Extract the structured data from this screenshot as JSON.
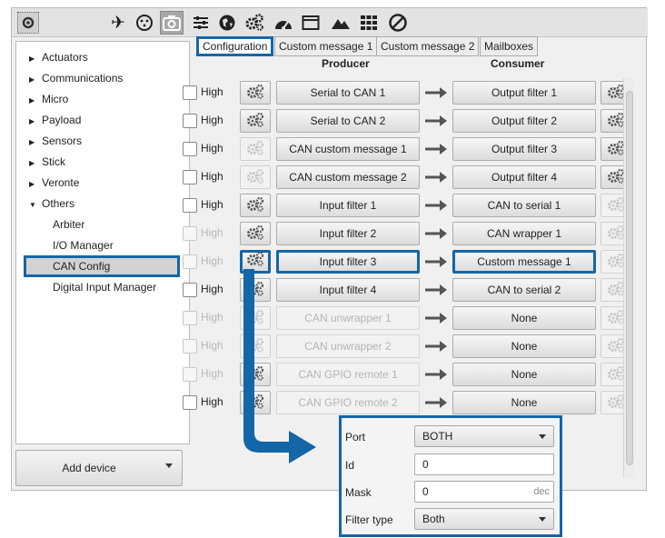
{
  "sidebar": {
    "items": [
      {
        "label": "Actuators",
        "expanded": false
      },
      {
        "label": "Communications",
        "expanded": false
      },
      {
        "label": "Micro",
        "expanded": false
      },
      {
        "label": "Payload",
        "expanded": false
      },
      {
        "label": "Sensors",
        "expanded": false
      },
      {
        "label": "Stick",
        "expanded": false
      },
      {
        "label": "Veronte",
        "expanded": false
      },
      {
        "label": "Others",
        "expanded": true
      }
    ],
    "children": [
      "Arbiter",
      "I/O Manager",
      "CAN Config",
      "Digital Input Manager"
    ],
    "selected": "CAN Config",
    "add_device_label": "Add device"
  },
  "tabs": [
    "Configuration",
    "Custom message 1",
    "Custom message 2",
    "Mailboxes"
  ],
  "columns": {
    "producer": "Producer",
    "consumer": "Consumer"
  },
  "high_label": "High",
  "rows": [
    {
      "producer": "Serial to CAN 1",
      "consumer": "Output filter 1",
      "enabled": true,
      "pgear": true,
      "cgear": true
    },
    {
      "producer": "Serial to CAN 2",
      "consumer": "Output filter 2",
      "enabled": true,
      "pgear": true,
      "cgear": true
    },
    {
      "producer": "CAN custom message 1",
      "consumer": "Output filter 3",
      "enabled": true,
      "pgear": false,
      "cgear": true
    },
    {
      "producer": "CAN custom message 2",
      "consumer": "Output filter 4",
      "enabled": true,
      "pgear": false,
      "cgear": true
    },
    {
      "producer": "Input filter 1",
      "consumer": "CAN to serial 1",
      "enabled": true,
      "pgear": true,
      "cgear": false
    },
    {
      "producer": "Input filter 2",
      "consumer": "CAN wrapper 1",
      "enabled": false,
      "pgear": true,
      "cgear": false
    },
    {
      "producer": "Input filter 3",
      "consumer": "Custom message 1",
      "enabled": false,
      "pgear": true,
      "cgear": false
    },
    {
      "producer": "Input filter 4",
      "consumer": "CAN to serial 2",
      "enabled": true,
      "pgear": true,
      "cgear": false
    },
    {
      "producer": "CAN unwrapper 1",
      "consumer": "None",
      "enabled": false,
      "pgear": false,
      "cgear": false
    },
    {
      "producer": "CAN unwrapper 2",
      "consumer": "None",
      "enabled": false,
      "pgear": false,
      "cgear": false
    },
    {
      "producer": "CAN GPIO remote 1",
      "consumer": "None",
      "enabled": false,
      "pgear": true,
      "cgear": false
    },
    {
      "producer": "CAN GPIO remote 2",
      "consumer": "None",
      "enabled": true,
      "pgear": true,
      "cgear": false
    }
  ],
  "filter_popup": {
    "port_label": "Port",
    "port_value": "BOTH",
    "id_label": "Id",
    "id_value": "0",
    "mask_label": "Mask",
    "mask_value": "0",
    "mask_unit": "dec",
    "filter_type_label": "Filter type",
    "filter_type_value": "Both"
  },
  "colors": {
    "highlight": "#1366a8"
  }
}
